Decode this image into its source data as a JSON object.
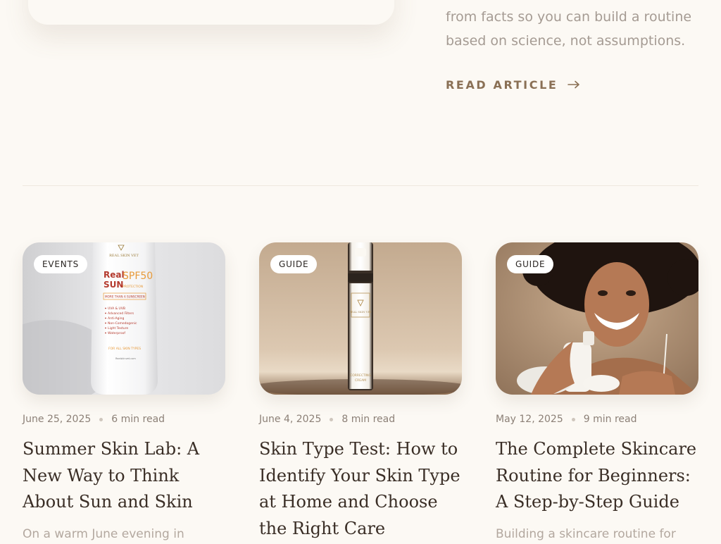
{
  "intro": {
    "text_lines": [
      "from facts so you can build a routine",
      "based on science, not assumptions."
    ],
    "read_article_label": "READ ARTICLE",
    "arrow_icon": "arrow-right-icon"
  },
  "articles": [
    {
      "category": "EVENTS",
      "date": "June 25, 2025",
      "read_time": "6 min read",
      "title": "Summer Skin Lab: A New Way to Think About Sun and Skin",
      "excerpt": "On a warm June evening in",
      "image_text": {
        "brand": "REAL SKIN VET",
        "product_line1": "Real",
        "product_line2": "SUN",
        "spf": "SPF50",
        "protection": "PROTECTION",
        "tagline": "MORE THAN A SUNSCREEN",
        "features": [
          "UVA & UVB",
          "Advanced Filters",
          "Anti-Aging",
          "Non-Comedogenic",
          "Light Texture",
          "Waterproof"
        ],
        "skin_types": "FOR ALL SKIN TYPES",
        "website": "Realskinvet.com"
      }
    },
    {
      "category": "GUIDE",
      "date": "June 4, 2025",
      "read_time": "8 min read",
      "title": "Skin Type Test: How to Identify Your Skin Type at Home and Choose the Right Care",
      "excerpt": "",
      "image_text": {
        "brand": "REAL SKIN VET",
        "product_line1": "CORRECTING",
        "product_line2": "CREAM"
      }
    },
    {
      "category": "GUIDE",
      "date": "May 12, 2025",
      "read_time": "9 min read",
      "title": "The Complete Skincare Routine for Beginners: A Step-by-Step Guide",
      "excerpt": "Building a skincare routine for"
    }
  ],
  "colors": {
    "background": "#fcf9f4",
    "accent": "#8a7055",
    "title": "#3a2e26",
    "muted_text": "#a59b93",
    "badge_bg": "#ffffff"
  }
}
